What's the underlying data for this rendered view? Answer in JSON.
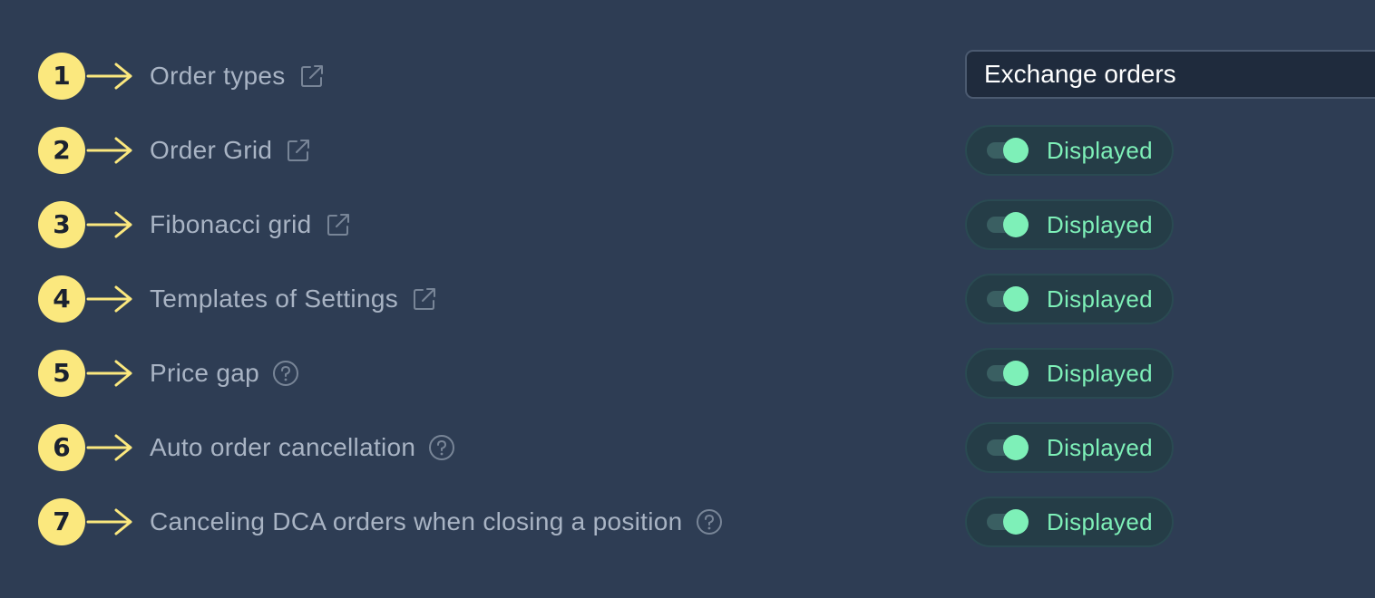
{
  "colors": {
    "background": "#2e3d54",
    "badge": "#fbe87e",
    "arrow": "#fbe87e",
    "label": "#a9b4c4",
    "toggle_on": "#7ef0b8"
  },
  "settings": [
    {
      "number": "1",
      "label": "Order types",
      "icon": "external-link-icon",
      "control": "select",
      "value": "Exchange orders"
    },
    {
      "number": "2",
      "label": "Order Grid",
      "icon": "external-link-icon",
      "control": "toggle",
      "value": "Displayed",
      "on": true
    },
    {
      "number": "3",
      "label": "Fibonacci grid",
      "icon": "external-link-icon",
      "control": "toggle",
      "value": "Displayed",
      "on": true
    },
    {
      "number": "4",
      "label": "Templates of Settings",
      "icon": "external-link-icon",
      "control": "toggle",
      "value": "Displayed",
      "on": true
    },
    {
      "number": "5",
      "label": "Price gap",
      "icon": "help-circle-icon",
      "control": "toggle",
      "value": "Displayed",
      "on": true
    },
    {
      "number": "6",
      "label": "Auto order cancellation",
      "icon": "help-circle-icon",
      "control": "toggle",
      "value": "Displayed",
      "on": true
    },
    {
      "number": "7",
      "label": "Canceling DCA orders when closing a position",
      "icon": "help-circle-icon",
      "control": "toggle",
      "value": "Displayed",
      "on": true
    }
  ]
}
